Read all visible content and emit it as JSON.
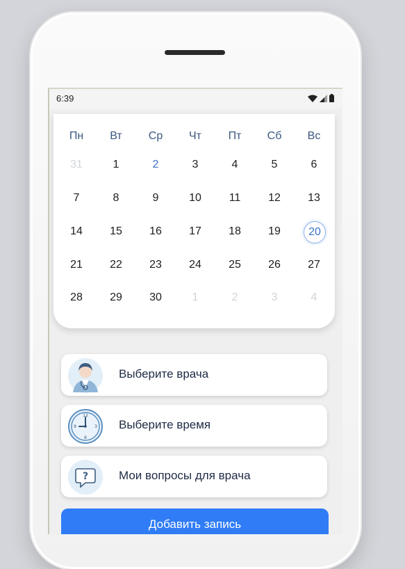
{
  "status_bar": {
    "time": "6:39"
  },
  "calendar": {
    "weekdays": [
      "Пн",
      "Вт",
      "Ср",
      "Чт",
      "Пт",
      "Сб",
      "Вс"
    ],
    "weeks": [
      [
        {
          "d": "31",
          "s": "muted"
        },
        {
          "d": "1",
          "s": "normal"
        },
        {
          "d": "2",
          "s": "highlight"
        },
        {
          "d": "3",
          "s": "normal"
        },
        {
          "d": "4",
          "s": "normal"
        },
        {
          "d": "5",
          "s": "normal"
        },
        {
          "d": "6",
          "s": "normal"
        }
      ],
      [
        {
          "d": "7",
          "s": "normal"
        },
        {
          "d": "8",
          "s": "normal"
        },
        {
          "d": "9",
          "s": "normal"
        },
        {
          "d": "10",
          "s": "normal"
        },
        {
          "d": "11",
          "s": "normal"
        },
        {
          "d": "12",
          "s": "normal"
        },
        {
          "d": "13",
          "s": "normal"
        }
      ],
      [
        {
          "d": "14",
          "s": "normal"
        },
        {
          "d": "15",
          "s": "normal"
        },
        {
          "d": "16",
          "s": "normal"
        },
        {
          "d": "17",
          "s": "normal"
        },
        {
          "d": "18",
          "s": "normal"
        },
        {
          "d": "19",
          "s": "normal"
        },
        {
          "d": "20",
          "s": "today"
        }
      ],
      [
        {
          "d": "21",
          "s": "normal"
        },
        {
          "d": "22",
          "s": "normal"
        },
        {
          "d": "23",
          "s": "normal"
        },
        {
          "d": "24",
          "s": "normal"
        },
        {
          "d": "25",
          "s": "normal"
        },
        {
          "d": "26",
          "s": "normal"
        },
        {
          "d": "27",
          "s": "normal"
        }
      ],
      [
        {
          "d": "28",
          "s": "normal"
        },
        {
          "d": "29",
          "s": "normal"
        },
        {
          "d": "30",
          "s": "normal"
        },
        {
          "d": "1",
          "s": "muted"
        },
        {
          "d": "2",
          "s": "muted"
        },
        {
          "d": "3",
          "s": "muted"
        },
        {
          "d": "4",
          "s": "muted"
        }
      ]
    ]
  },
  "actions": {
    "doctor": {
      "label": "Выберите врача",
      "icon": "doctor-icon"
    },
    "time": {
      "label": "Выберите время",
      "icon": "clock-icon"
    },
    "questions": {
      "label": "Мои вопросы для врача",
      "icon": "question-bubble-icon"
    }
  },
  "add_button": {
    "label": "Добавить запись"
  },
  "colors": {
    "accent": "#2f7cf6",
    "selected_date": "#3a72c8",
    "weekday_text": "#3b5680",
    "icon_blue": "#5a8fc0"
  }
}
